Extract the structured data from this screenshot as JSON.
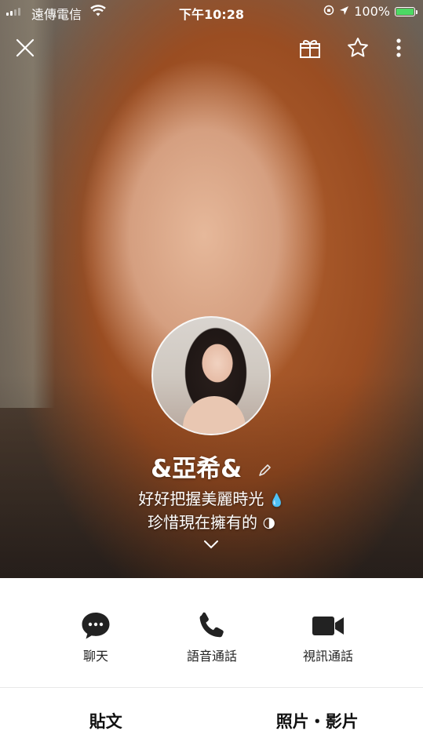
{
  "status_bar": {
    "carrier": "遠傳電信",
    "time": "下午10:28",
    "battery_percent": "100%",
    "signal_bars_filled": 2,
    "signal_bars_total": 4,
    "battery_level": 1.0,
    "battery_color": "#4cd964"
  },
  "header": {
    "close_icon": "close-icon",
    "gift_icon": "gift-icon",
    "favorite_icon": "star-icon",
    "more_icon": "more-vertical-icon"
  },
  "profile": {
    "name": "&亞希&",
    "bio_line1": "好好把握美麗時光",
    "bio_line2": "珍惜現在擁有的",
    "emoji_after_line1": "💧",
    "emoji_after_line2": "🌗"
  },
  "actions": [
    {
      "label": "聊天",
      "icon": "chat-bubble-icon"
    },
    {
      "label": "語音通話",
      "icon": "phone-icon"
    },
    {
      "label": "視訊通話",
      "icon": "video-camera-icon"
    }
  ],
  "tabs": [
    {
      "label": "貼文"
    },
    {
      "label": "照片・影片"
    }
  ]
}
